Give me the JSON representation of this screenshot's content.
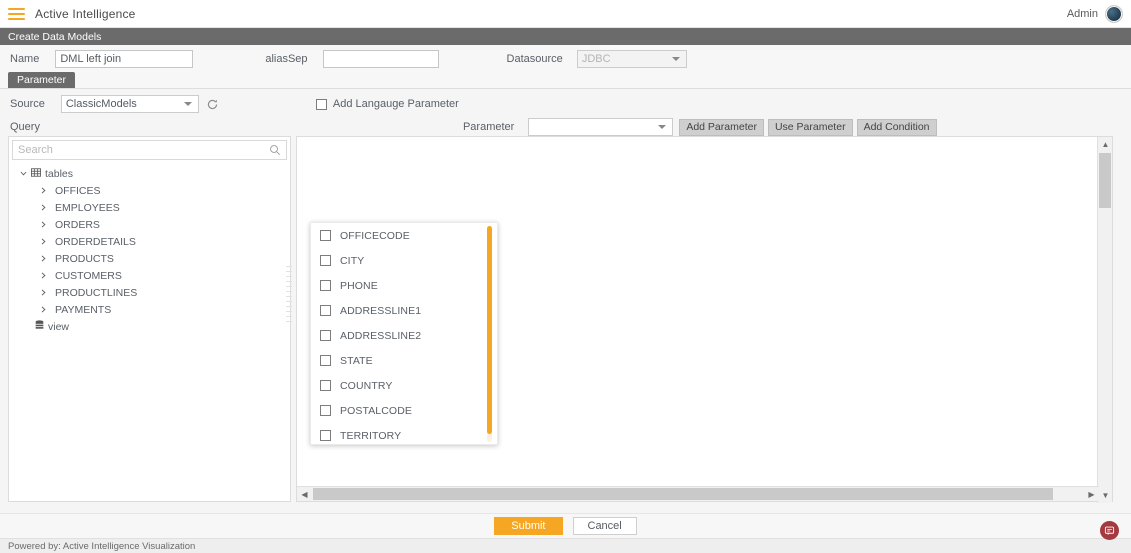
{
  "topbar": {
    "menu_icon": "hamburger-icon",
    "app_title": "Active Intelligence",
    "admin_label": "Admin",
    "avatar_icon": "user-avatar"
  },
  "page_strip": {
    "title": "Create Data Models"
  },
  "form": {
    "name_label": "Name",
    "name_value": "DML left join",
    "aliassep_label": "aliasSep",
    "aliassep_value": "",
    "aliassep_placeholder": "",
    "datasource_label": "Datasource",
    "datasource_value": "JDBC"
  },
  "tabs": {
    "parameter_tab": "Parameter"
  },
  "source_row": {
    "source_label": "Source",
    "source_value": "ClassicModels",
    "refresh_icon": "refresh-icon",
    "add_language_param_label": "Add Langauge Parameter",
    "add_language_param_checked": false
  },
  "query_row": {
    "query_label": "Query",
    "parameter_label": "Parameter",
    "parameter_value": "",
    "buttons": [
      {
        "label": "Add Parameter",
        "name": "add-parameter-button"
      },
      {
        "label": "Use Parameter",
        "name": "use-parameter-button"
      },
      {
        "label": "Add Condition",
        "name": "add-condition-button"
      }
    ]
  },
  "tree_panel": {
    "search_placeholder": "Search",
    "search_value": "",
    "search_icon": "search-icon",
    "nodes": [
      {
        "label": "tables",
        "level": 0,
        "expanded": true,
        "icon": "table-icon"
      },
      {
        "label": "OFFICES",
        "level": 1,
        "expanded": false
      },
      {
        "label": "EMPLOYEES",
        "level": 1,
        "expanded": false
      },
      {
        "label": "ORDERS",
        "level": 1,
        "expanded": false
      },
      {
        "label": "ORDERDETAILS",
        "level": 1,
        "expanded": false
      },
      {
        "label": "PRODUCTS",
        "level": 1,
        "expanded": false
      },
      {
        "label": "CUSTOMERS",
        "level": 1,
        "expanded": false
      },
      {
        "label": "PRODUCTLINES",
        "level": 1,
        "expanded": false
      },
      {
        "label": "PAYMENTS",
        "level": 1,
        "expanded": false
      },
      {
        "label": "view",
        "level": 0,
        "expanded": false,
        "icon": "view-icon"
      }
    ]
  },
  "column_popup": {
    "items": [
      {
        "label": "OFFICECODE",
        "checked": false
      },
      {
        "label": "CITY",
        "checked": false
      },
      {
        "label": "PHONE",
        "checked": false
      },
      {
        "label": "ADDRESSLINE1",
        "checked": false
      },
      {
        "label": "ADDRESSLINE2",
        "checked": false
      },
      {
        "label": "STATE",
        "checked": false
      },
      {
        "label": "COUNTRY",
        "checked": false
      },
      {
        "label": "POSTALCODE",
        "checked": false
      },
      {
        "label": "TERRITORY",
        "checked": false
      }
    ]
  },
  "footer": {
    "submit_label": "Submit",
    "cancel_label": "Cancel",
    "powered_by": "Powered by: Active Intelligence Visualization",
    "chat_icon": "chat-feedback-icon"
  },
  "colors": {
    "accent": "#f5a623",
    "header_strip": "#6b6b6b",
    "chat_fab": "#a33a3f"
  }
}
